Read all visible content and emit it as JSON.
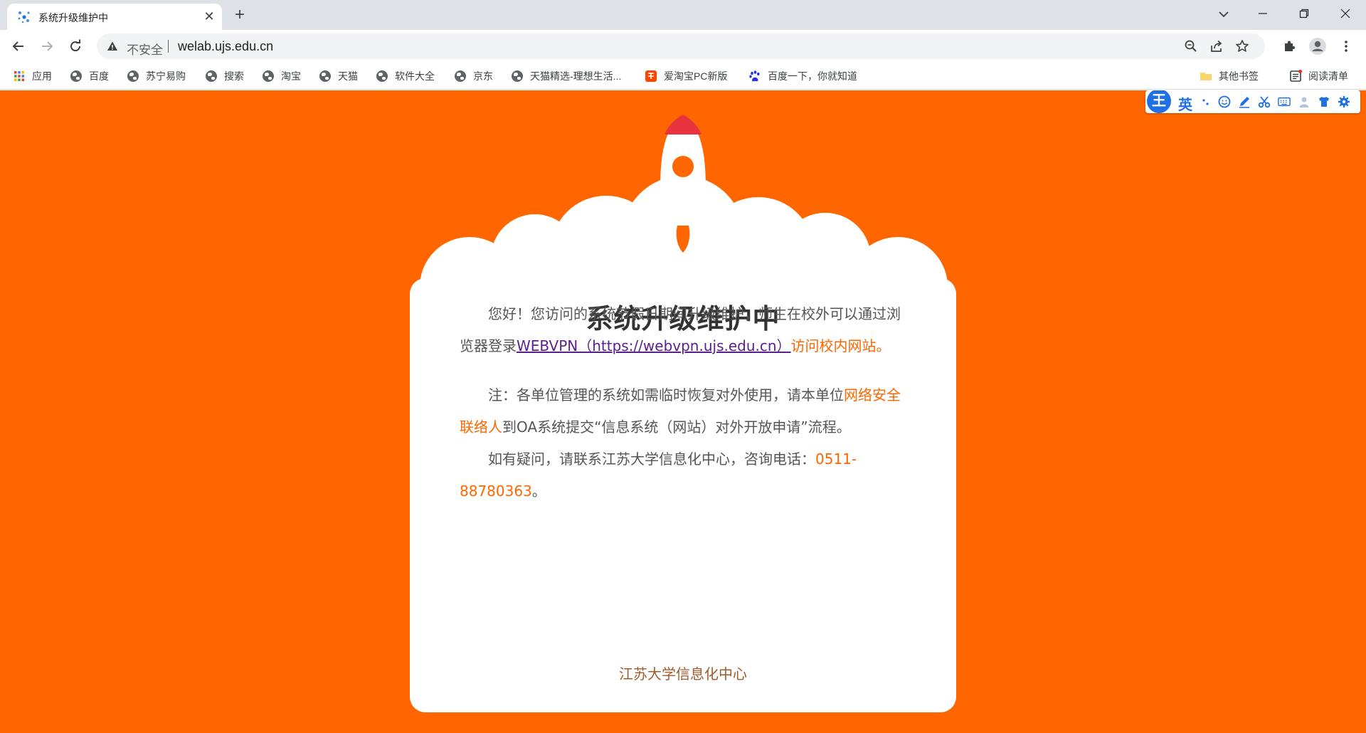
{
  "browser": {
    "tab": {
      "title": "系统升级维护中",
      "close_glyph": "✕"
    },
    "new_tab_glyph": "+",
    "address_bar": {
      "security_label": "不安全",
      "url": "welab.ujs.edu.cn"
    },
    "bookmarks": [
      {
        "label": "应用",
        "icon": "apps-grid-icon"
      },
      {
        "label": "百度",
        "icon": "globe-icon"
      },
      {
        "label": "苏宁易购",
        "icon": "globe-icon"
      },
      {
        "label": "搜索",
        "icon": "globe-icon"
      },
      {
        "label": "淘宝",
        "icon": "globe-icon"
      },
      {
        "label": "天猫",
        "icon": "globe-icon"
      },
      {
        "label": "软件大全",
        "icon": "globe-icon"
      },
      {
        "label": "京东",
        "icon": "globe-icon"
      },
      {
        "label": "天猫精选-理想生活...",
        "icon": "globe-icon"
      },
      {
        "label": "爱淘宝PC新版",
        "icon": "aitaobao-icon"
      },
      {
        "label": "百度一下，你就知道",
        "icon": "baidu-paw-icon"
      }
    ],
    "other_bookmarks": "其他书签",
    "reading_list": "阅读清单"
  },
  "ime_toolbar": {
    "logo": "王",
    "lang": "英"
  },
  "page": {
    "title": "系统升级维护中",
    "para1": {
      "before": "您好！您访问的系统节假日期间升级维护，师生在校外可以通过浏览器登录",
      "link": "WEBVPN（https://webvpn.ujs.edu.cn）",
      "after": "访问校内网站。"
    },
    "para2": {
      "before": "注：各单位管理的系统如需临时恢复对外使用，请本单位",
      "highlight": "网络安全联络人",
      "after": "到OA系统提交“信息系统（网站）对外开放申请”流程。"
    },
    "para3": {
      "before": "如有疑问，请联系江苏大学信息化中心，咨询电话：",
      "phone": "0511-88780363",
      "after": "。"
    },
    "footer": "江苏大学信息化中心"
  },
  "colors": {
    "page_background": "#ff6600",
    "accent": "#ff6600",
    "rocket_nose": "#e8333f",
    "link": "#5b1f8f",
    "title_text": "#333333"
  }
}
